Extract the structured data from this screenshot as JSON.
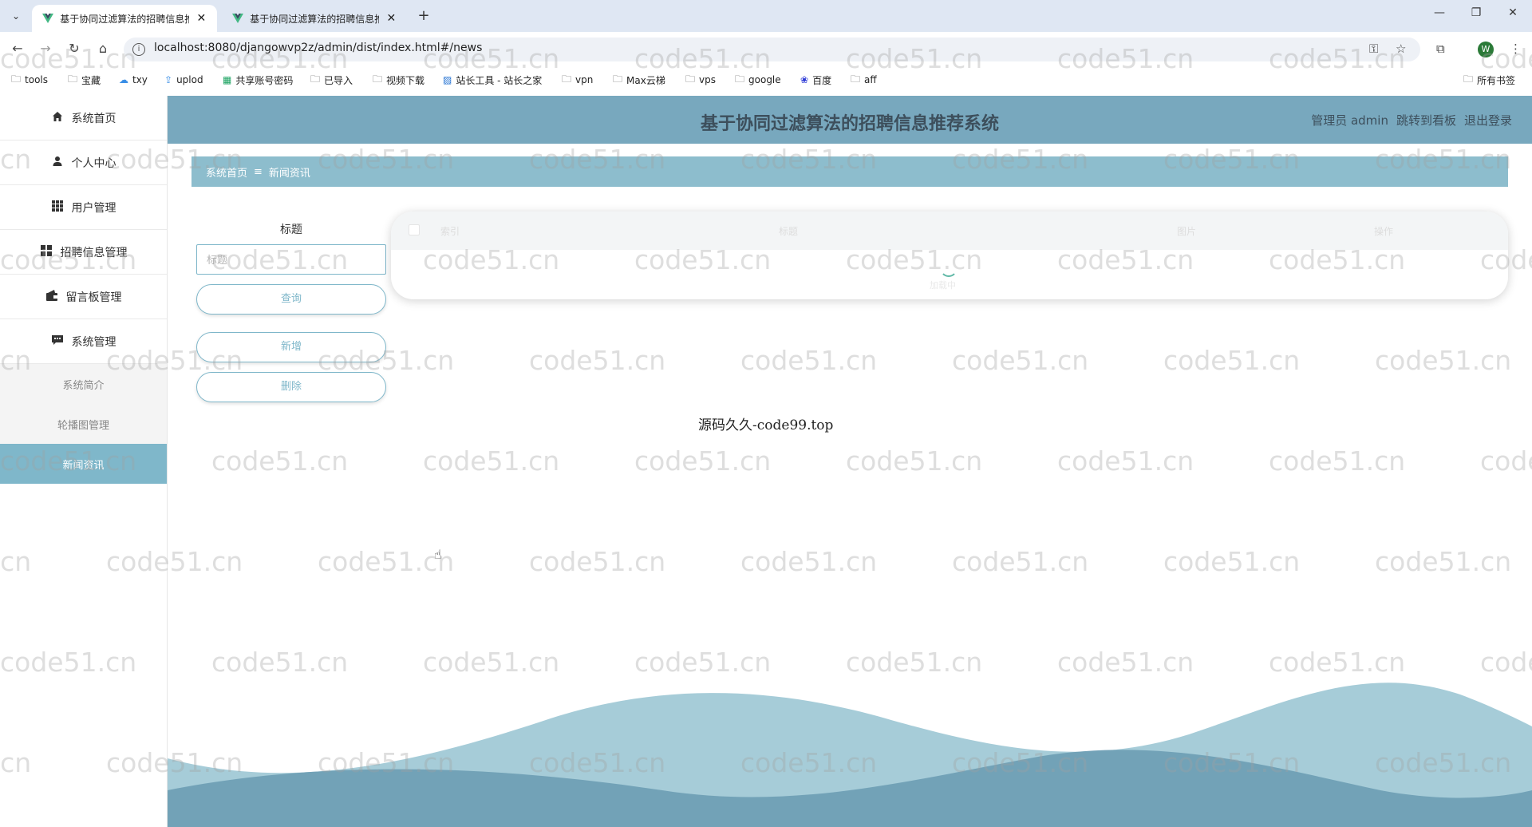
{
  "browser": {
    "tabs": [
      {
        "title": "基于协同过滤算法的招聘信息推荐系统",
        "active": true
      },
      {
        "title": "基于协同过滤算法的招聘信息推荐系统",
        "active": false
      }
    ],
    "url": "localhost:8080/djangowvp2z/admin/dist/index.html#/news",
    "bookmarks": [
      "tools",
      "宝藏",
      "txy",
      "uplod",
      "共享账号密码",
      "已导入",
      "视频下载",
      "站长工具 - 站长之家",
      "vpn",
      "Max云梯",
      "vps",
      "google",
      "百度",
      "aff"
    ],
    "all_bookmarks": "所有书签",
    "profile_initial": "W"
  },
  "sidebar": {
    "items": [
      {
        "label": "系统首页",
        "icon": "home-icon"
      },
      {
        "label": "个人中心",
        "icon": "user-icon"
      },
      {
        "label": "用户管理",
        "icon": "grid-icon"
      },
      {
        "label": "招聘信息管理",
        "icon": "apps-icon"
      },
      {
        "label": "留言板管理",
        "icon": "wallet-icon"
      },
      {
        "label": "系统管理",
        "icon": "message-icon"
      }
    ],
    "sub_items": [
      {
        "label": "系统简介",
        "active": false
      },
      {
        "label": "轮播图管理",
        "active": false
      },
      {
        "label": "新闻资讯",
        "active": true
      }
    ]
  },
  "header": {
    "title": "基于协同过滤算法的招聘信息推荐系统",
    "user": "管理员 admin",
    "dashboard_link": "跳转到看板",
    "logout_link": "退出登录"
  },
  "breadcrumb": {
    "home": "系统首页",
    "separator": "≡",
    "current": "新闻资讯"
  },
  "search": {
    "label": "标题",
    "placeholder": "标题",
    "query_button": "查询",
    "add_button": "新增",
    "delete_button": "删除"
  },
  "table": {
    "headers": [
      "索引",
      "标题",
      "图片",
      "操作"
    ],
    "loading_text": "加载中"
  },
  "footer_text": "源码久久-code99.top",
  "watermark": "code51.cn",
  "colors": {
    "accent": "#7fb7ca",
    "header_bg": "#78a8be",
    "breadcrumb_bg": "#8dbdcd"
  }
}
